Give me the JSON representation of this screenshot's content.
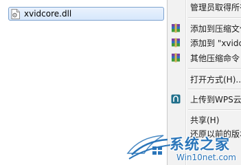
{
  "explorer": {
    "selected_file": "xvidcore.dll"
  },
  "context_menu": {
    "items": [
      {
        "label": "管理员取得所有",
        "icon": "none"
      },
      {
        "label": "添加到压缩文件",
        "icon": "winrar-icon"
      },
      {
        "label": "添加到 \"xvidc",
        "icon": "winrar-icon"
      },
      {
        "label": "其他压缩命令",
        "icon": "winrar-icon"
      },
      {
        "label": "打开方式(H)...",
        "icon": "none"
      },
      {
        "label": "上传到WPS云",
        "icon": "wps-cloud-icon"
      },
      {
        "label": "共享(H)",
        "icon": "none"
      },
      {
        "label": "还原以前的版本",
        "icon": "none"
      }
    ]
  },
  "watermark": {
    "title": "系统之家",
    "url": "Win10net.com"
  },
  "colors": {
    "selection_border": "#7da2ce",
    "selection_fill": "#d6e7fb",
    "menu_background": "#f2f2f2",
    "watermark_blue": "#2a75b9"
  }
}
